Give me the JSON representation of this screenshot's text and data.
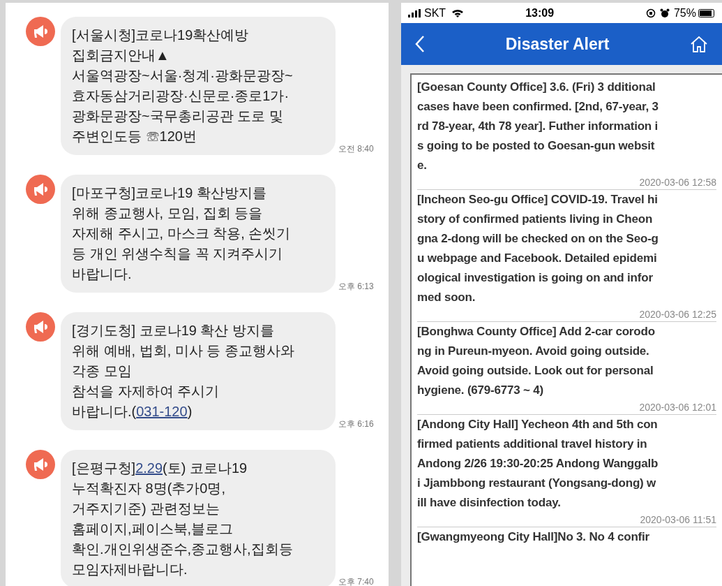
{
  "sms_panel": {
    "messages": [
      {
        "lines": [
          "[서울시청]코로나19확산예방",
          "집회금지안내▲",
          "서울역광장~서울·청계·광화문광장~",
          "효자동삼거리광장·신문로·종로1가·",
          "광화문광장~국무총리공관 도로 및",
          "주변인도등 ☏120번"
        ],
        "time": "오전 8:40"
      },
      {
        "lines": [
          "[마포구청]코로나19 확산방지를",
          "위해 종교행사, 모임, 집회 등을",
          "자제해 주시고, 마스크 착용, 손씻기",
          "등 개인 위생수칙을 꼭 지켜주시기",
          "바랍니다."
        ],
        "time": "오후 6:13"
      },
      {
        "lines": [
          "[경기도청] 코로나19 확산 방지를",
          "위해 예배, 법회, 미사 등 종교행사와",
          "각종 모임",
          "참석을 자제하여 주시기",
          {
            "before": "바랍니다.(",
            "link": "031-120",
            "after": ")"
          }
        ],
        "time": "오후 6:16"
      },
      {
        "lines": [
          {
            "before": "[은평구청]",
            "link": "2.29",
            "after": "(토) 코로나19"
          },
          "누적확진자 8명(추가0명,",
          "거주지기준) 관련정보는",
          "홈페이지,페이스북,블로그",
          "확인.개인위생준수,종교행사,집회등",
          "모임자제바랍니다."
        ],
        "time": "오후 7:40"
      }
    ]
  },
  "alert_app": {
    "status_bar": {
      "carrier": "SKT",
      "time": "13:09",
      "battery": "75%"
    },
    "header": {
      "title": "Disaster Alert"
    },
    "alerts": [
      {
        "lines": [
          "[Goesan County Office] 3.6. (Fri) 3 dditional",
          "cases have been confirmed. [2nd, 67-year, 3",
          "rd 78-year, 4th 78 year]. Futher information i",
          "s going to be posted to Goesan-gun websit",
          "e."
        ],
        "time": "2020-03-06 12:58"
      },
      {
        "lines": [
          "[Incheon Seo-gu Office] COVID-19. Travel hi",
          "story of confirmed patients living in Cheon",
          "gna 2-dong will be checked on on the Seo-g",
          "u webpage and Facebook. Detailed epidemi",
          "ological investigation is going on and infor",
          "med soon."
        ],
        "time": "2020-03-06 12:25"
      },
      {
        "lines": [
          "[Bonghwa County Office] Add 2-car corodo",
          "ng in Pureun-myeon. Avoid going outside.",
          "Avoid going outside. Look out for personal",
          "hygiene. (679-6773 ~ 4)"
        ],
        "time": "2020-03-06 12:01"
      },
      {
        "lines": [
          "[Andong City Hall] Yecheon 4th and 5th con",
          "firmed patients additional travel history in",
          "Andong 2/26 19:30-20:25 Andong Wanggalb",
          "i Jjambbong restaurant (Yongsang-dong) w",
          "ill have disinfection today."
        ],
        "time": "2020-03-06 11:51"
      },
      {
        "lines": [
          "[Gwangmyeong City Hall]No 3. No 4 confir"
        ]
      }
    ]
  }
}
